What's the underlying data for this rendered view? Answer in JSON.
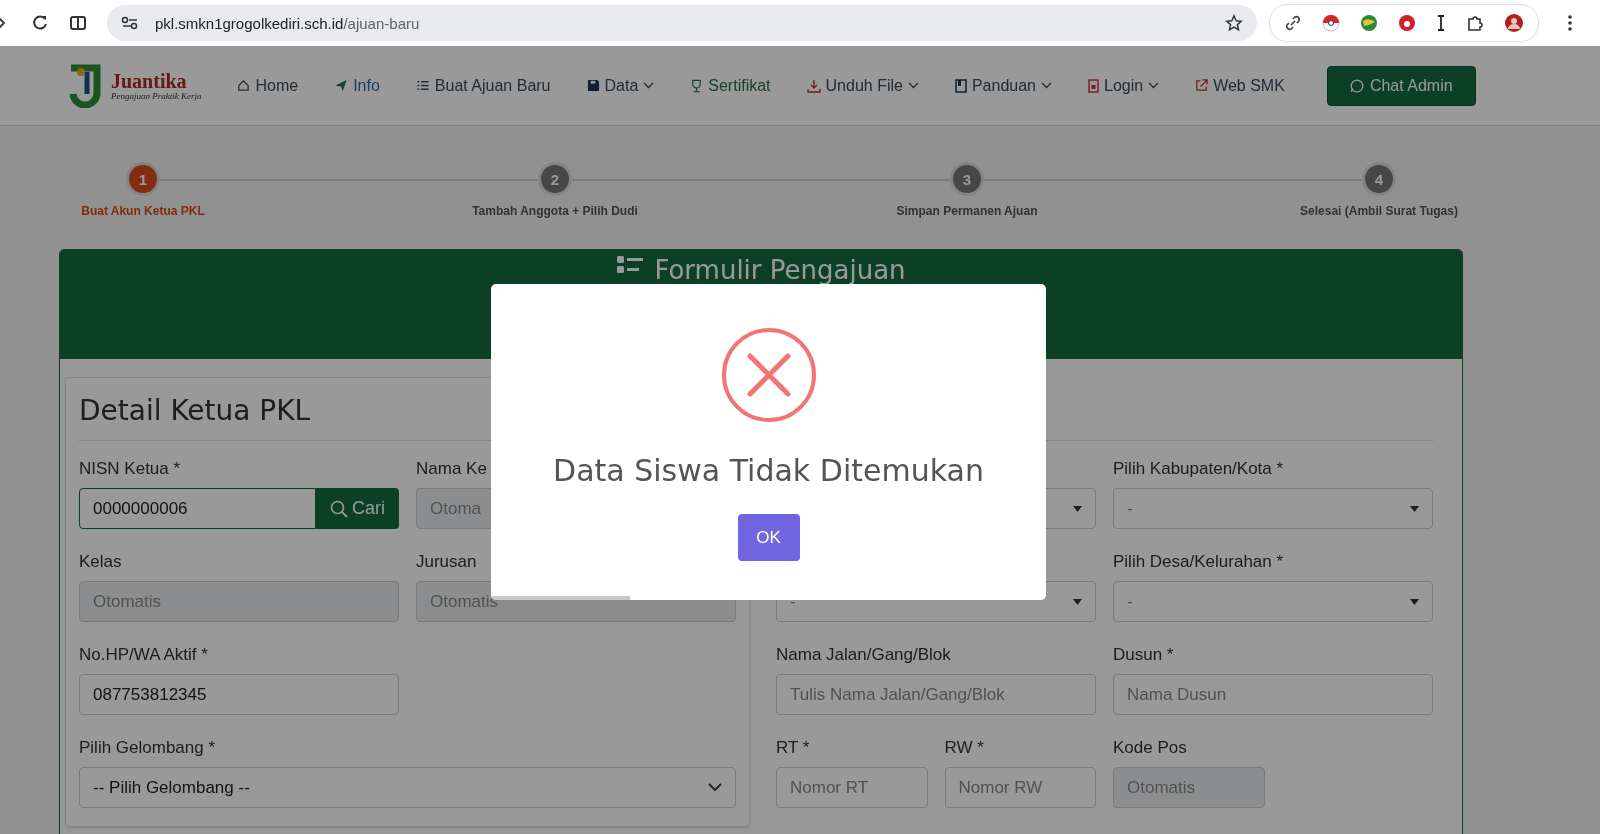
{
  "browser": {
    "url_host": "pkl.smkn1grogolkediri.sch.id",
    "url_path": "/ajuan-baru"
  },
  "nav": {
    "logo_title": "Juantika",
    "logo_tagline": "Pengajuan Praktik Kerja",
    "items": [
      {
        "label": "Home",
        "dropdown": false
      },
      {
        "label": "Info",
        "dropdown": false
      },
      {
        "label": "Buat Ajuan Baru",
        "dropdown": false
      },
      {
        "label": "Data",
        "dropdown": true
      },
      {
        "label": "Sertifikat",
        "dropdown": false
      },
      {
        "label": "Unduh File",
        "dropdown": true
      },
      {
        "label": "Panduan",
        "dropdown": true
      },
      {
        "label": "Login",
        "dropdown": true
      },
      {
        "label": "Web SMK",
        "dropdown": false
      }
    ],
    "chat_button": "Chat Admin"
  },
  "steps": [
    {
      "number": "1",
      "label": "Buat Akun Ketua PKL",
      "selected": true
    },
    {
      "number": "2",
      "label": "Tambah Anggota + Pilih Dudi",
      "selected": false
    },
    {
      "number": "3",
      "label": "Simpan Permanen Ajuan",
      "selected": false
    },
    {
      "number": "4",
      "label": "Selesai (Ambil Surat Tugas)",
      "selected": false
    }
  ],
  "form": {
    "title": "Formulir Pengajuan",
    "section_title": "Detail Ketua PKL",
    "left": [
      {
        "label": "NISN Ketua *",
        "kind": "search",
        "value": "0000000006",
        "button": "Cari",
        "disabled": false
      },
      {
        "label": "Nama Ke",
        "kind": "input",
        "placeholder": "Otoma",
        "disabled": true
      },
      {
        "label": "Kelas",
        "kind": "input",
        "placeholder": "Otomatis",
        "disabled": true
      },
      {
        "label": "Jurusan",
        "kind": "input",
        "placeholder": "Otomatis",
        "disabled": true
      },
      {
        "label": "No.HP/WA Aktif *",
        "kind": "input",
        "value": "087753812345",
        "disabled": false
      },
      {
        "kind": "spacer"
      },
      {
        "label": "Pilih Gelombang *",
        "kind": "select",
        "value": "-- Pilih Gelombang --"
      }
    ],
    "right": [
      {
        "kind": "dropdown"
      },
      {
        "label": "Pilih Kabupaten/Kota *",
        "kind": "dropdown",
        "placeholder": "-"
      },
      {
        "kind": "dropdown",
        "placeholder": "-"
      },
      {
        "label": "Pilih Desa/Kelurahan *",
        "kind": "dropdown",
        "placeholder": "-"
      },
      {
        "label": "Nama Jalan/Gang/Blok",
        "kind": "input",
        "placeholder": "Tulis Nama Jalan/Gang/Blok",
        "disabled": false
      },
      {
        "label": "Dusun *",
        "kind": "input",
        "placeholder": "Nama Dusun",
        "disabled": false
      },
      {
        "label": "RT *",
        "kind": "short-input",
        "placeholder": "Nomor RT",
        "disabled": false
      },
      {
        "label": "RW *",
        "kind": "short-input",
        "placeholder": "Nomor RW",
        "disabled": false
      },
      {
        "label": "Kode Pos",
        "kind": "short-input",
        "placeholder": "Otomatis",
        "disabled": true
      }
    ]
  },
  "modal": {
    "message": "Data Siswa Tidak Ditemukan",
    "button": "OK",
    "timer": {
      "level": 0.25
    }
  }
}
